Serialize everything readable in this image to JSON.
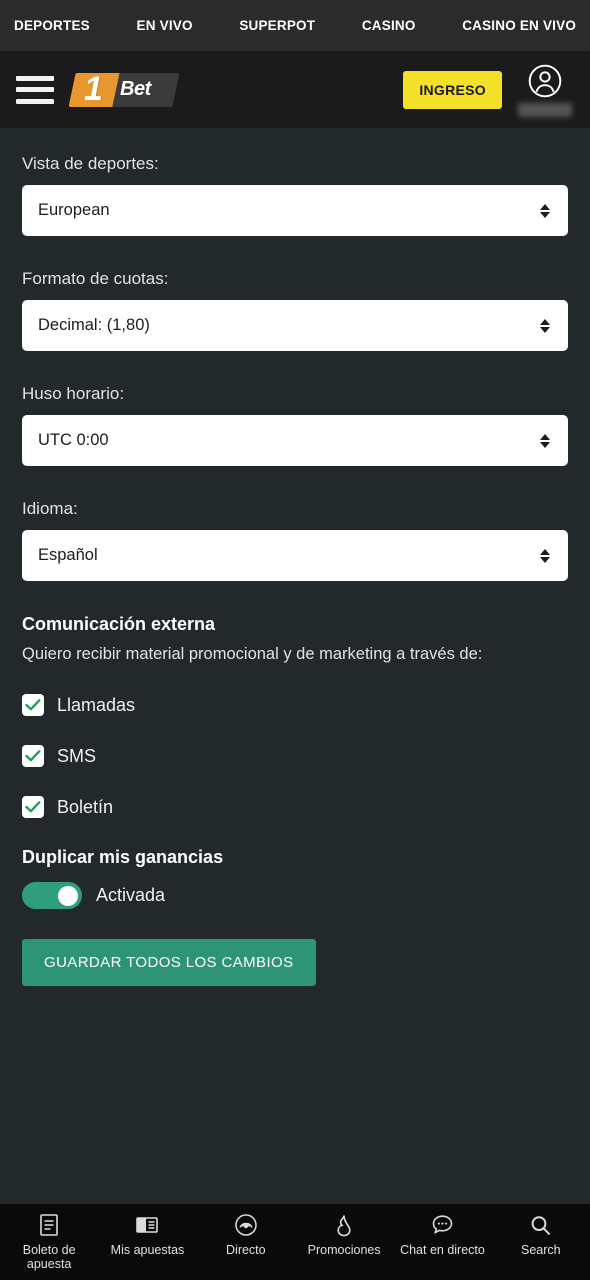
{
  "topnav": {
    "items": [
      {
        "label": "DEPORTES"
      },
      {
        "label": "EN VIVO"
      },
      {
        "label": "SUPERPOT"
      },
      {
        "label": "CASINO"
      },
      {
        "label": "CASINO EN VIVO"
      }
    ]
  },
  "header": {
    "menu_icon": "hamburger-menu-icon",
    "logo_one": "1",
    "logo_bet": "Bet",
    "login_label": "INGRESO",
    "avatar_icon": "user-avatar-icon"
  },
  "settings": {
    "fields": [
      {
        "label": "Vista de deportes:",
        "value": "European",
        "name": "sports-view"
      },
      {
        "label": "Formato de cuotas:",
        "value": "Decimal: (1,80)",
        "name": "odds-format"
      },
      {
        "label": "Huso horario:",
        "value": "UTC 0:00",
        "name": "timezone"
      },
      {
        "label": "Idioma:",
        "value": "Español",
        "name": "language"
      }
    ]
  },
  "communication": {
    "title": "Comunicación externa",
    "subtitle": "Quiero recibir material promocional y de marketing a través de:",
    "options": [
      {
        "label": "Llamadas",
        "checked": true
      },
      {
        "label": "SMS",
        "checked": true
      },
      {
        "label": "Boletín",
        "checked": true
      }
    ]
  },
  "winnings": {
    "title": "Duplicar mis ganancias",
    "toggle_label": "Activada",
    "toggle_on": true
  },
  "actions": {
    "save_label": "GUARDAR TODOS LOS CAMBIOS"
  },
  "bottomnav": {
    "items": [
      {
        "label": "Boleto de apuesta",
        "icon": "betslip-icon"
      },
      {
        "label": "Mis apuestas",
        "icon": "my-bets-icon"
      },
      {
        "label": "Directo",
        "icon": "live-broadcast-icon"
      },
      {
        "label": "Promociones",
        "icon": "flame-icon"
      },
      {
        "label": "Chat en directo",
        "icon": "chat-bubble-icon"
      },
      {
        "label": "Search",
        "icon": "search-icon"
      }
    ]
  },
  "colors": {
    "background": "#23282b",
    "accent_yellow": "#f4e028",
    "accent_teal": "#2e9478",
    "logo_orange": "#e8972e"
  }
}
